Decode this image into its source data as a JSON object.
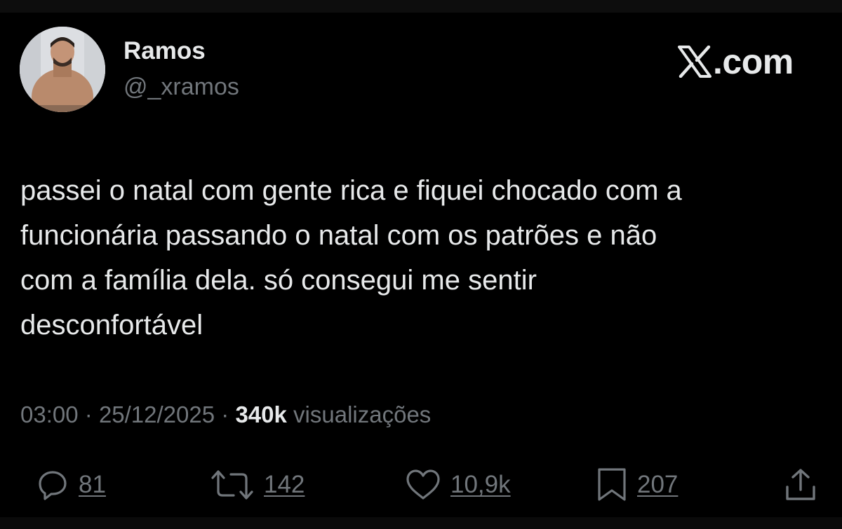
{
  "author": {
    "display_name": "Ramos",
    "handle": "@_xramos",
    "avatar_icon": "profile-photo"
  },
  "brand": {
    "logo_icon": "x-logo-icon",
    "text": ".com"
  },
  "tweet": {
    "lines": [
      "passei o natal com gente rica e fiquei chocado com a",
      "funcionária passando o natal com os patrões e não",
      "com a família dela. só consegui me sentir",
      "desconfortável"
    ]
  },
  "meta": {
    "time": "03:00",
    "separator": "·",
    "date": "25/12/2025",
    "views_count": "340k",
    "views_label": "visualizações"
  },
  "actions": {
    "replies": {
      "icon": "reply-icon",
      "count": "81"
    },
    "reposts": {
      "icon": "repost-icon",
      "count": "142"
    },
    "likes": {
      "icon": "heart-icon",
      "count": "10,9k"
    },
    "bookmarks": {
      "icon": "bookmark-icon",
      "count": "207"
    },
    "share": {
      "icon": "share-icon"
    }
  },
  "colors": {
    "background": "#000000",
    "primary_text": "#e7e9ea",
    "secondary_text": "#71767b"
  }
}
